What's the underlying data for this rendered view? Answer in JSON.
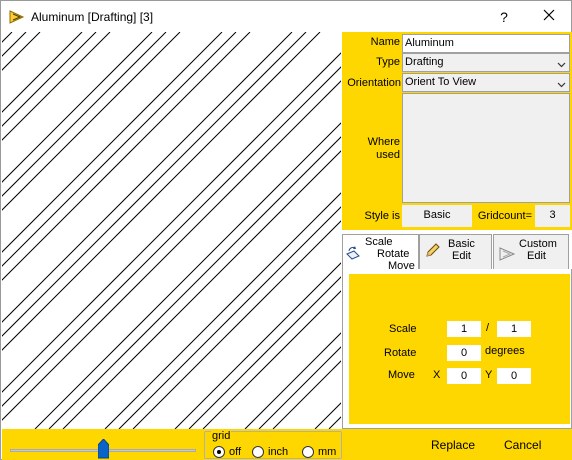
{
  "window": {
    "title": "Aluminum [Drafting] [3]",
    "help_label": "?",
    "close_icon": "close-icon"
  },
  "properties": {
    "name_label": "Name",
    "name_value": "Aluminum",
    "type_label": "Type",
    "type_value": "Drafting",
    "orientation_label": "Orientation",
    "orientation_value": "Orient To View",
    "where_used_label_1": "Where",
    "where_used_label_2": "used",
    "style_label": "Style is",
    "style_value": "Basic",
    "gridcount_label": "Gridcount=",
    "gridcount_value": "3"
  },
  "tabs": [
    {
      "line1": "Scale",
      "line2": "Rotate",
      "line3": "Move",
      "icon": "scale-rotate-move-icon",
      "active": true
    },
    {
      "line1": "Basic",
      "line2": "Edit",
      "icon": "pencil-icon",
      "active": false
    },
    {
      "line1": "Custom",
      "line2": "Edit",
      "icon": "custom-edit-icon",
      "active": false
    }
  ],
  "edit": {
    "scale_label": "Scale",
    "scale_num": "1",
    "scale_sep": "/",
    "scale_den": "1",
    "rotate_label": "Rotate",
    "rotate_value": "0",
    "rotate_unit": "degrees",
    "move_label": "Move",
    "x_label": "X",
    "x_value": "0",
    "y_label": "Y",
    "y_value": "0"
  },
  "footer": {
    "slider_level": 0.5,
    "grid_label": "grid",
    "grid_options": [
      "off",
      "inch",
      "mm"
    ],
    "grid_selected": "off",
    "replace_label": "Replace",
    "cancel_label": "Cancel"
  },
  "colors": {
    "panel_yellow": "#ffd700",
    "slider_thumb": "#0a64c8"
  }
}
